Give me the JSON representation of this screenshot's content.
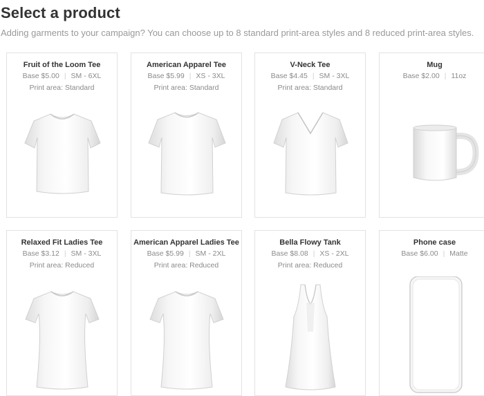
{
  "page": {
    "title": "Select a product",
    "subtitle": "Adding garments to your campaign? You can choose up to 8 standard print-area styles and 8 reduced print-area styles."
  },
  "products": [
    {
      "name": "Fruit of the Loom Tee",
      "base": "Base $5.00",
      "option": "SM - 6XL",
      "print_area": "Print area: Standard",
      "icon": "tshirt-icon"
    },
    {
      "name": "American Apparel Tee",
      "base": "Base $5.99",
      "option": "XS - 3XL",
      "print_area": "Print area: Standard",
      "icon": "tshirt-icon"
    },
    {
      "name": "V-Neck Tee",
      "base": "Base $4.45",
      "option": "SM - 3XL",
      "print_area": "Print area: Standard",
      "icon": "vneck-tshirt-icon"
    },
    {
      "name": "Mug",
      "base": "Base $2.00",
      "option": "11oz",
      "print_area": "",
      "icon": "mug-icon"
    },
    {
      "name": "Relaxed Fit Ladies Tee",
      "base": "Base $3.12",
      "option": "SM - 3XL",
      "print_area": "Print area: Reduced",
      "icon": "ladies-tshirt-icon"
    },
    {
      "name": "American Apparel Ladies Tee",
      "base": "Base $5.99",
      "option": "SM - 2XL",
      "print_area": "Print area: Reduced",
      "icon": "ladies-tshirt-icon"
    },
    {
      "name": "Bella Flowy Tank",
      "base": "Base $8.08",
      "option": "XS - 2XL",
      "print_area": "Print area: Reduced",
      "icon": "tank-top-icon"
    },
    {
      "name": "Phone case",
      "base": "Base $6.00",
      "option": "Matte",
      "print_area": "",
      "icon": "phone-case-icon"
    }
  ]
}
